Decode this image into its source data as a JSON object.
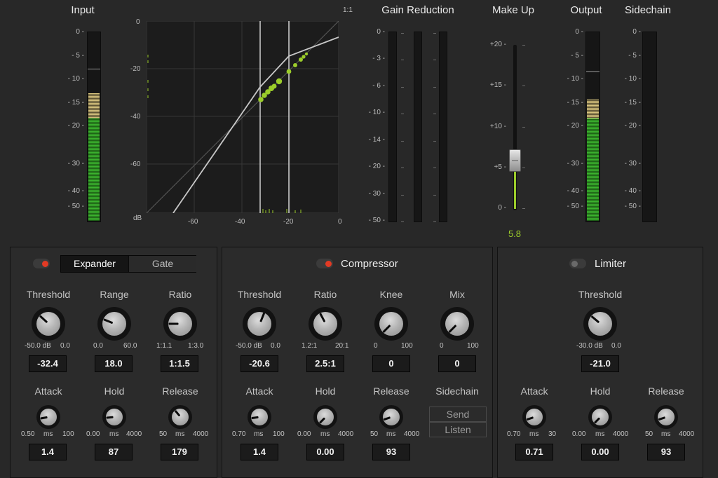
{
  "meters": {
    "input": {
      "title": "Input",
      "scale": [
        "0 -",
        "- 5 -",
        "- 10 -",
        "- 15 -",
        "- 20 -",
        "- 30 -",
        "- 40 -",
        "- 50 -"
      ],
      "peak_hold_db": -8,
      "yellow_top_db": -13,
      "green_top_db": -18
    },
    "gain_reduction": {
      "title": "Gain Reduction",
      "scale": [
        "0 -",
        "- 3 -",
        "- 6 -",
        "- 10 -",
        "- 14 -",
        "- 20 -",
        "- 30 -",
        "- 50 -"
      ]
    },
    "output": {
      "title": "Output",
      "scale": [
        "0 -",
        "- 5 -",
        "- 10 -",
        "- 15 -",
        "- 20 -",
        "- 30 -",
        "- 40 -",
        "- 50 -"
      ],
      "peak_hold_db": -8.5,
      "yellow_top_db": -14,
      "green_top_db": -18
    },
    "sidechain": {
      "title": "Sidechain",
      "scale": [
        "0 -",
        "- 5 -",
        "- 10 -",
        "- 15 -",
        "- 20 -",
        "- 30 -",
        "- 40 -",
        "- 50 -"
      ]
    }
  },
  "graph": {
    "ratio_label": "1:1",
    "unit_label": "dB",
    "y_ticks": [
      "0",
      "-20",
      "-40",
      "-60"
    ],
    "x_ticks": [
      "-60",
      "-40",
      "-20",
      "0"
    ]
  },
  "makeup": {
    "title": "Make Up",
    "scale": [
      "+20 -",
      "+15 -",
      "+10 -",
      "+5 -",
      "0 -"
    ],
    "value": "5.8",
    "value_db": 5.8
  },
  "colors": {
    "accent_green": "#9bcc2a",
    "led_red": "#e23a24",
    "led_off": "#6a6a6a"
  },
  "expander": {
    "mode_active": "Expander",
    "mode_inactive": "Gate",
    "enabled": true,
    "threshold": {
      "label": "Threshold",
      "min": "-50.0 dB",
      "max": "0.0",
      "value": "-32.4"
    },
    "range": {
      "label": "Range",
      "min": "0.0",
      "max": "60.0",
      "value": "18.0"
    },
    "ratio": {
      "label": "Ratio",
      "min": "1:1.1",
      "max": "1:3.0",
      "value": "1:1.5"
    },
    "attack": {
      "label": "Attack",
      "min": "0.50",
      "unit": "ms",
      "max": "100",
      "value": "1.4"
    },
    "hold": {
      "label": "Hold",
      "min": "0.00",
      "unit": "ms",
      "max": "4000",
      "value": "87"
    },
    "release": {
      "label": "Release",
      "min": "50",
      "unit": "ms",
      "max": "4000",
      "value": "179"
    }
  },
  "compressor": {
    "title": "Compressor",
    "enabled": true,
    "threshold": {
      "label": "Threshold",
      "min": "-50.0 dB",
      "max": "0.0",
      "value": "-20.6"
    },
    "ratio": {
      "label": "Ratio",
      "min": "1.2:1",
      "max": "20:1",
      "value": "2.5:1"
    },
    "knee": {
      "label": "Knee",
      "min": "0",
      "max": "100",
      "value": "0"
    },
    "mix": {
      "label": "Mix",
      "min": "0",
      "max": "100",
      "value": "0"
    },
    "attack": {
      "label": "Attack",
      "min": "0.70",
      "unit": "ms",
      "max": "100",
      "value": "1.4"
    },
    "hold": {
      "label": "Hold",
      "min": "0.00",
      "unit": "ms",
      "max": "4000",
      "value": "0.00"
    },
    "release": {
      "label": "Release",
      "min": "50",
      "unit": "ms",
      "max": "4000",
      "value": "93"
    },
    "sidechain": {
      "label": "Sidechain",
      "send": "Send",
      "listen": "Listen"
    }
  },
  "limiter": {
    "title": "Limiter",
    "enabled": false,
    "threshold": {
      "label": "Threshold",
      "min": "-30.0 dB",
      "max": "0.0",
      "value": "-21.0"
    },
    "attack": {
      "label": "Attack",
      "min": "0.70",
      "unit": "ms",
      "max": "30",
      "value": "0.71"
    },
    "hold": {
      "label": "Hold",
      "min": "0.00",
      "unit": "ms",
      "max": "4000",
      "value": "0.00"
    },
    "release": {
      "label": "Release",
      "min": "50",
      "unit": "ms",
      "max": "4000",
      "value": "93"
    }
  }
}
